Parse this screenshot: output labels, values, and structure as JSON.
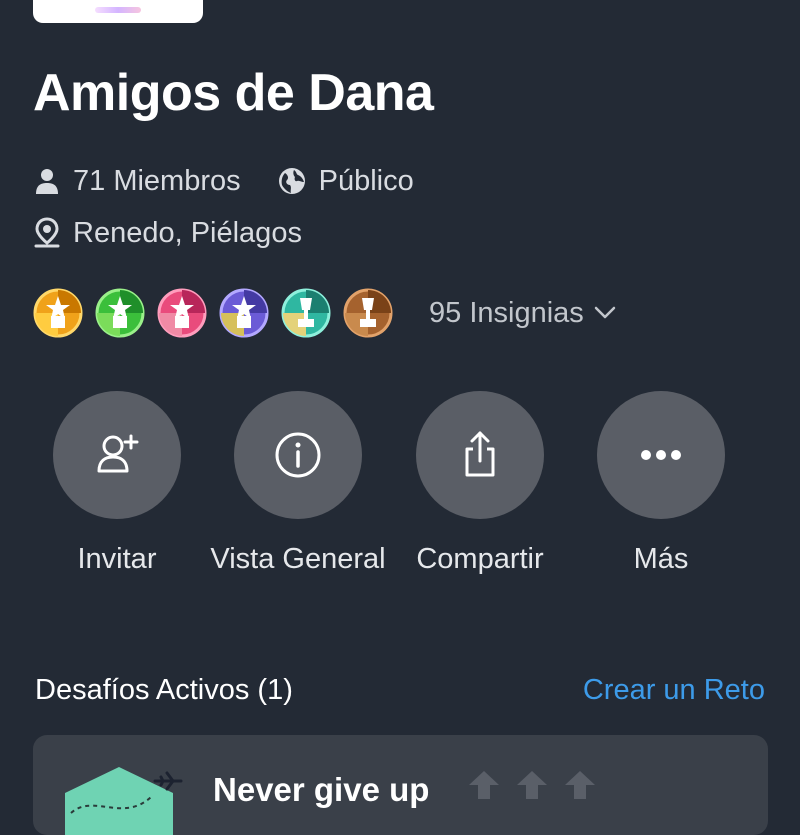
{
  "group": {
    "title": "Amigos de Dana",
    "members": "71 Miembros",
    "visibility": "Público",
    "location": "Renedo, Piélagos"
  },
  "badges": {
    "count_label": "95 Insignias",
    "items": [
      {
        "name": "badge-orange",
        "color": "#f0a21a"
      },
      {
        "name": "badge-green",
        "color": "#3bbf3b"
      },
      {
        "name": "badge-pink",
        "color": "#e94b7c"
      },
      {
        "name": "badge-purple",
        "color": "#6b5bd6"
      },
      {
        "name": "badge-teal",
        "color": "#2fb7a1"
      },
      {
        "name": "badge-bronze",
        "color": "#a5622e"
      }
    ]
  },
  "actions": [
    {
      "label": "Invitar",
      "icon": "add-user-icon"
    },
    {
      "label": "Vista General",
      "icon": "info-icon"
    },
    {
      "label": "Compartir",
      "icon": "share-icon"
    },
    {
      "label": "Más",
      "icon": "more-icon"
    }
  ],
  "challenges": {
    "section_title": "Desafíos Activos (1)",
    "create_link": "Crear un Reto",
    "items": [
      {
        "title": "Never give up"
      }
    ]
  },
  "colors": {
    "background": "#232a35",
    "accent": "#3d9be9",
    "button_circle": "#5a5e66",
    "card": "#3a4049"
  }
}
